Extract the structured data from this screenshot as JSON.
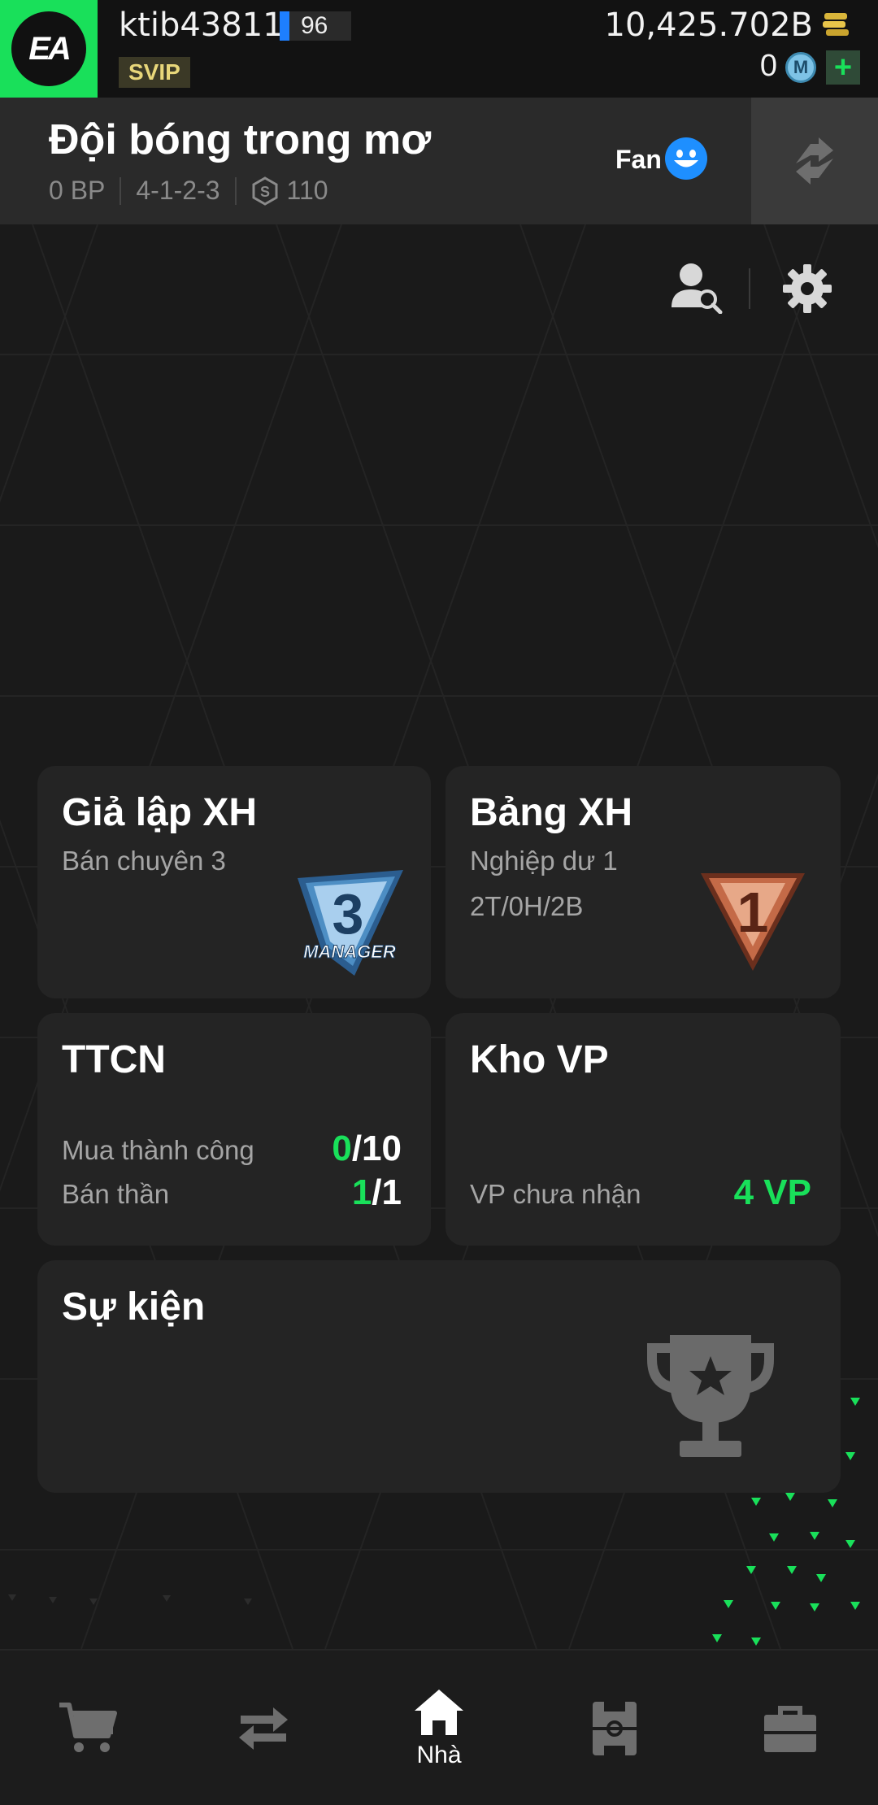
{
  "topbar": {
    "logo_text": "EA",
    "username": "ktib43811",
    "level": "96",
    "vip_badge": "SVIP",
    "coins": "10,425.702B",
    "mc_count": "0",
    "mc_icon_letter": "M",
    "add_label": "+"
  },
  "team": {
    "name": "Đội bóng trong mơ",
    "bp": "0 BP",
    "formation": "4-1-2-3",
    "s_letter": "S",
    "score": "110",
    "fan_label": "Fan"
  },
  "cards": {
    "rank_sim": {
      "title": "Giả lập XH",
      "tier": "Bán chuyên 3",
      "badge_number": "3",
      "badge_text": "MANAGER"
    },
    "leaderboard": {
      "title": "Bảng XH",
      "tier": "Nghiệp dư 1",
      "record": "2T/0H/2B",
      "badge_number": "1"
    },
    "ttcn": {
      "title": "TTCN",
      "buy_label": "Mua thành công",
      "buy_done": "0",
      "buy_total": "/10",
      "sell_label": "Bán thần",
      "sell_done": "1",
      "sell_total": "/1"
    },
    "storage": {
      "title": "Kho VP",
      "unclaimed_label": "VP chưa nhận",
      "unclaimed_value": "4 VP"
    },
    "events": {
      "title": "Sự kiện"
    }
  },
  "nav": {
    "home_label": "Nhà"
  },
  "colors": {
    "accent": "#19e05a",
    "background": "#1a1a1a",
    "card": "#242424",
    "level_bar": "#1e7fff"
  },
  "icons": [
    "ea-logo",
    "coin-stack-icon",
    "mc-coin-icon",
    "plus-icon",
    "s-badge-icon",
    "smiley-icon",
    "sync-icon",
    "user-search-icon",
    "gear-icon",
    "manager-rank-badge",
    "rank-one-badge",
    "trophy-icon",
    "cart-icon",
    "transfer-icon",
    "home-icon",
    "pitch-icon",
    "bag-icon"
  ]
}
